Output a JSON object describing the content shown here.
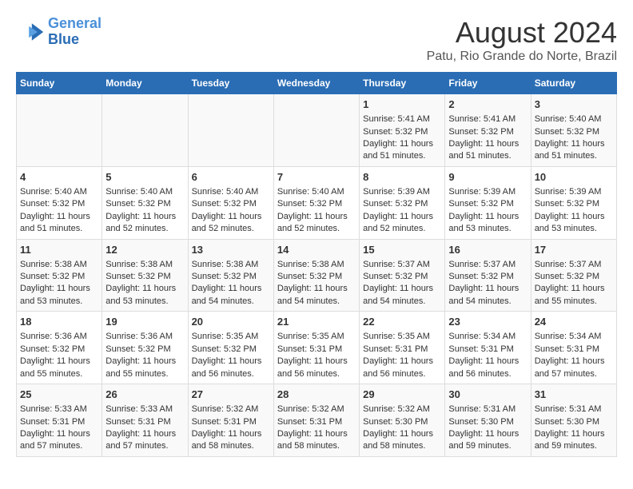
{
  "logo": {
    "line1": "General",
    "line2": "Blue"
  },
  "title": "August 2024",
  "subtitle": "Patu, Rio Grande do Norte, Brazil",
  "days_header": [
    "Sunday",
    "Monday",
    "Tuesday",
    "Wednesday",
    "Thursday",
    "Friday",
    "Saturday"
  ],
  "weeks": [
    [
      {
        "day": "",
        "content": ""
      },
      {
        "day": "",
        "content": ""
      },
      {
        "day": "",
        "content": ""
      },
      {
        "day": "",
        "content": ""
      },
      {
        "day": "1",
        "content": "Sunrise: 5:41 AM\nSunset: 5:32 PM\nDaylight: 11 hours\nand 51 minutes."
      },
      {
        "day": "2",
        "content": "Sunrise: 5:41 AM\nSunset: 5:32 PM\nDaylight: 11 hours\nand 51 minutes."
      },
      {
        "day": "3",
        "content": "Sunrise: 5:40 AM\nSunset: 5:32 PM\nDaylight: 11 hours\nand 51 minutes."
      }
    ],
    [
      {
        "day": "4",
        "content": "Sunrise: 5:40 AM\nSunset: 5:32 PM\nDaylight: 11 hours\nand 51 minutes."
      },
      {
        "day": "5",
        "content": "Sunrise: 5:40 AM\nSunset: 5:32 PM\nDaylight: 11 hours\nand 52 minutes."
      },
      {
        "day": "6",
        "content": "Sunrise: 5:40 AM\nSunset: 5:32 PM\nDaylight: 11 hours\nand 52 minutes."
      },
      {
        "day": "7",
        "content": "Sunrise: 5:40 AM\nSunset: 5:32 PM\nDaylight: 11 hours\nand 52 minutes."
      },
      {
        "day": "8",
        "content": "Sunrise: 5:39 AM\nSunset: 5:32 PM\nDaylight: 11 hours\nand 52 minutes."
      },
      {
        "day": "9",
        "content": "Sunrise: 5:39 AM\nSunset: 5:32 PM\nDaylight: 11 hours\nand 53 minutes."
      },
      {
        "day": "10",
        "content": "Sunrise: 5:39 AM\nSunset: 5:32 PM\nDaylight: 11 hours\nand 53 minutes."
      }
    ],
    [
      {
        "day": "11",
        "content": "Sunrise: 5:38 AM\nSunset: 5:32 PM\nDaylight: 11 hours\nand 53 minutes."
      },
      {
        "day": "12",
        "content": "Sunrise: 5:38 AM\nSunset: 5:32 PM\nDaylight: 11 hours\nand 53 minutes."
      },
      {
        "day": "13",
        "content": "Sunrise: 5:38 AM\nSunset: 5:32 PM\nDaylight: 11 hours\nand 54 minutes."
      },
      {
        "day": "14",
        "content": "Sunrise: 5:38 AM\nSunset: 5:32 PM\nDaylight: 11 hours\nand 54 minutes."
      },
      {
        "day": "15",
        "content": "Sunrise: 5:37 AM\nSunset: 5:32 PM\nDaylight: 11 hours\nand 54 minutes."
      },
      {
        "day": "16",
        "content": "Sunrise: 5:37 AM\nSunset: 5:32 PM\nDaylight: 11 hours\nand 54 minutes."
      },
      {
        "day": "17",
        "content": "Sunrise: 5:37 AM\nSunset: 5:32 PM\nDaylight: 11 hours\nand 55 minutes."
      }
    ],
    [
      {
        "day": "18",
        "content": "Sunrise: 5:36 AM\nSunset: 5:32 PM\nDaylight: 11 hours\nand 55 minutes."
      },
      {
        "day": "19",
        "content": "Sunrise: 5:36 AM\nSunset: 5:32 PM\nDaylight: 11 hours\nand 55 minutes."
      },
      {
        "day": "20",
        "content": "Sunrise: 5:35 AM\nSunset: 5:32 PM\nDaylight: 11 hours\nand 56 minutes."
      },
      {
        "day": "21",
        "content": "Sunrise: 5:35 AM\nSunset: 5:31 PM\nDaylight: 11 hours\nand 56 minutes."
      },
      {
        "day": "22",
        "content": "Sunrise: 5:35 AM\nSunset: 5:31 PM\nDaylight: 11 hours\nand 56 minutes."
      },
      {
        "day": "23",
        "content": "Sunrise: 5:34 AM\nSunset: 5:31 PM\nDaylight: 11 hours\nand 56 minutes."
      },
      {
        "day": "24",
        "content": "Sunrise: 5:34 AM\nSunset: 5:31 PM\nDaylight: 11 hours\nand 57 minutes."
      }
    ],
    [
      {
        "day": "25",
        "content": "Sunrise: 5:33 AM\nSunset: 5:31 PM\nDaylight: 11 hours\nand 57 minutes."
      },
      {
        "day": "26",
        "content": "Sunrise: 5:33 AM\nSunset: 5:31 PM\nDaylight: 11 hours\nand 57 minutes."
      },
      {
        "day": "27",
        "content": "Sunrise: 5:32 AM\nSunset: 5:31 PM\nDaylight: 11 hours\nand 58 minutes."
      },
      {
        "day": "28",
        "content": "Sunrise: 5:32 AM\nSunset: 5:31 PM\nDaylight: 11 hours\nand 58 minutes."
      },
      {
        "day": "29",
        "content": "Sunrise: 5:32 AM\nSunset: 5:30 PM\nDaylight: 11 hours\nand 58 minutes."
      },
      {
        "day": "30",
        "content": "Sunrise: 5:31 AM\nSunset: 5:30 PM\nDaylight: 11 hours\nand 59 minutes."
      },
      {
        "day": "31",
        "content": "Sunrise: 5:31 AM\nSunset: 5:30 PM\nDaylight: 11 hours\nand 59 minutes."
      }
    ]
  ]
}
